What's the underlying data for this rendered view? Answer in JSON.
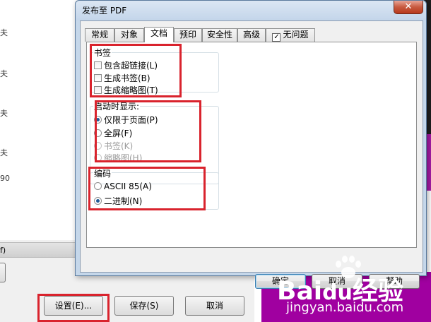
{
  "background": {
    "list_fragments": [
      "夫",
      "夫",
      "夫",
      "夫",
      "90"
    ],
    "strip_text": "f)",
    "buttons": {
      "settings": "设置(E)...",
      "save": "保存(S)",
      "cancel": "取消"
    }
  },
  "dialog": {
    "title": "发布至 PDF",
    "close_glyph": "✕",
    "tabs": [
      "常规",
      "对象",
      "文档",
      "预印",
      "安全性",
      "高级",
      "无问题"
    ],
    "active_tab": "文档",
    "bookmarks_group": {
      "title": "书签",
      "options": [
        {
          "label": "包含超链接(L)",
          "checked": false
        },
        {
          "label": "生成书签(B)",
          "checked": false
        },
        {
          "label": "生成缩略图(T)",
          "checked": false
        }
      ]
    },
    "startup_group": {
      "title": "启动时显示:",
      "options": [
        {
          "label": "仅限于页面(P)",
          "selected": true,
          "enabled": true
        },
        {
          "label": "全屏(F)",
          "selected": false,
          "enabled": true
        },
        {
          "label": "书签(K)",
          "selected": false,
          "enabled": false
        },
        {
          "label": "缩略图(H)",
          "selected": false,
          "enabled": false
        }
      ]
    },
    "encoding_group": {
      "title": "编码",
      "options": [
        {
          "label": "ASCII 85(A)",
          "selected": false
        },
        {
          "label": "二进制(N)",
          "selected": true
        }
      ]
    },
    "buttons": {
      "ok": "确定",
      "cancel": "取消",
      "help": "帮助"
    }
  },
  "watermark": {
    "logo_text_1": "Bai",
    "logo_text_2": "du",
    "logo_text_3": "经验",
    "url": "jingyan.baidu.com"
  },
  "colors": {
    "highlight_red": "#d9232d",
    "dialog_frame": "#c5d7ea",
    "watermark_purple": "#a000a0"
  }
}
